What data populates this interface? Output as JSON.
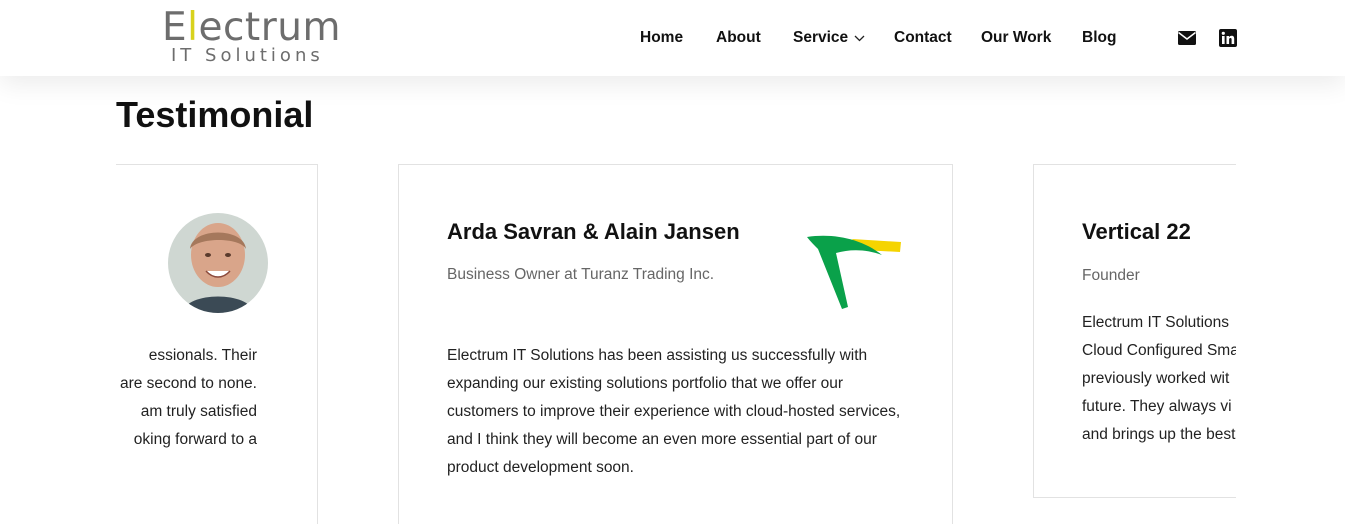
{
  "brand": {
    "logo_first": "E",
    "logo_accent": "l",
    "logo_rest": "ectrum",
    "logo_sub": "IT Solutions",
    "accent_color": "#d8d21d"
  },
  "nav": {
    "items": [
      "Home",
      "About",
      "Service",
      "Contact",
      "Our Work",
      "Blog"
    ],
    "icons": [
      "envelope-icon",
      "linkedin-icon"
    ]
  },
  "section": {
    "title": "Testimonial"
  },
  "testimonials": [
    {
      "quote_lines": [
        "essionals. Their",
        "are second to none.",
        "am truly satisfied",
        "oking forward to a"
      ]
    },
    {
      "name": "Arda Savran & Alain Jansen",
      "role": "Business Owner at Turanz Trading Inc.",
      "quote": "Electrum IT Solutions has been assisting us successfully with expanding our existing solutions portfolio that we offer our customers to improve their experience with cloud-hosted services, and I think they will become an even more essential part of our product development soon."
    },
    {
      "name": "Vertical 22",
      "role": "Founder",
      "quote_lines": [
        "Electrum IT Solutions",
        "Cloud Configured Sma",
        "previously worked wit",
        "future. They always vi",
        "and brings up the best"
      ]
    }
  ]
}
